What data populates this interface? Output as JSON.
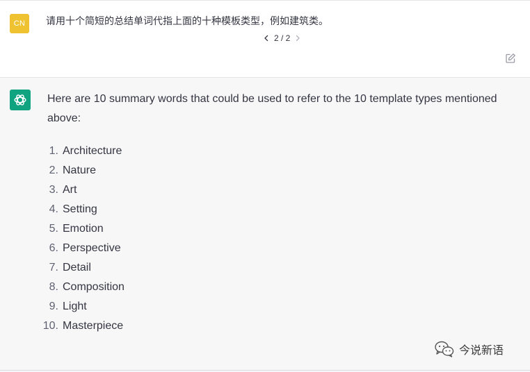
{
  "user": {
    "avatar_initials": "CN",
    "avatar_color": "#efc232",
    "message": "请用十个简短的总结单词代指上面的十种模板类型，例如建筑类。",
    "pager": "2 / 2",
    "prev_icon": "chevron-left-icon",
    "next_icon": "chevron-right-icon",
    "edit_icon": "edit-icon"
  },
  "assistant": {
    "avatar_color": "#10a37f",
    "avatar_icon": "openai-logo-icon",
    "intro": "Here are 10 summary words that could be used to refer to the 10 template types mentioned above:",
    "items": [
      {
        "num": "1.",
        "label": "Architecture"
      },
      {
        "num": "2.",
        "label": "Nature"
      },
      {
        "num": "3.",
        "label": "Art"
      },
      {
        "num": "4.",
        "label": "Setting"
      },
      {
        "num": "5.",
        "label": "Emotion"
      },
      {
        "num": "6.",
        "label": "Perspective"
      },
      {
        "num": "7.",
        "label": "Detail"
      },
      {
        "num": "8.",
        "label": "Composition"
      },
      {
        "num": "9.",
        "label": "Light"
      },
      {
        "num": "10.",
        "label": "Masterpiece"
      }
    ]
  },
  "watermark": {
    "text": "今说新语",
    "icon": "wechat-icon"
  }
}
